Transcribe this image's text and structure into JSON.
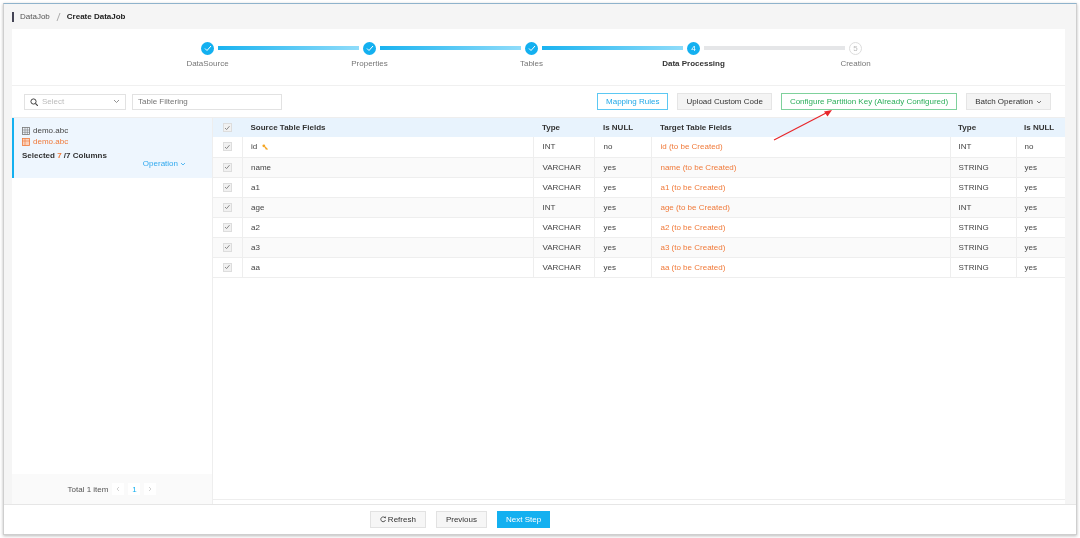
{
  "breadcrumb": [
    "DataJob",
    "Create DataJob"
  ],
  "steps": [
    {
      "label": "DataSource",
      "kind": "done"
    },
    {
      "label": "Properties",
      "kind": "done"
    },
    {
      "label": "Tables",
      "kind": "done"
    },
    {
      "label": "Data Processing",
      "kind": "current",
      "number": "4"
    },
    {
      "label": "Creation",
      "kind": "waiting",
      "number": "5"
    }
  ],
  "filters": {
    "select_placeholder": "Select",
    "table_placeholder": "Table Filtering"
  },
  "toolbar": [
    {
      "label": "Mapping Rules",
      "kind": "outline"
    },
    {
      "label": "Upload Custom Code",
      "kind": "plain"
    },
    {
      "label": "Configure Partition Key (Already Configured)",
      "kind": "success"
    },
    {
      "label": "Batch Operation",
      "kind": "dropdown"
    }
  ],
  "table_list": [
    {
      "source": "demo.abc",
      "target": "demo.abc",
      "selected": true,
      "summary_prefix": "Selected",
      "selected_count": "7",
      "summary_suffix": "/7 Columns",
      "operation": "Operation"
    }
  ],
  "pagination": {
    "total": "Total 1 item",
    "pages": [
      {
        "label": "1",
        "selected": true
      }
    ]
  },
  "table": {
    "header_checkbox": {
      "checked": true,
      "disabled": true
    },
    "columns": [
      "Source Table Fields",
      "Type",
      "Is NULL",
      "Target Table Fields",
      "Type",
      "Is NULL"
    ],
    "rows": [
      {
        "checked": true,
        "disabled": true,
        "source": "id",
        "primary_key": true,
        "type": "INT",
        "nullable": "no",
        "target": "id (to be Created)",
        "target_type": "INT",
        "target_nullable": "no"
      },
      {
        "checked": true,
        "disabled": true,
        "source": "name",
        "primary_key": false,
        "type": "VARCHAR",
        "nullable": "yes",
        "target": "name (to be Created)",
        "target_type": "STRING",
        "target_nullable": "yes"
      },
      {
        "checked": true,
        "disabled": true,
        "source": "a1",
        "primary_key": false,
        "type": "VARCHAR",
        "nullable": "yes",
        "target": "a1 (to be Created)",
        "target_type": "STRING",
        "target_nullable": "yes"
      },
      {
        "checked": true,
        "disabled": true,
        "source": "age",
        "primary_key": false,
        "type": "INT",
        "nullable": "yes",
        "target": "age (to be Created)",
        "target_type": "INT",
        "target_nullable": "yes"
      },
      {
        "checked": true,
        "disabled": true,
        "source": "a2",
        "primary_key": false,
        "type": "VARCHAR",
        "nullable": "yes",
        "target": "a2 (to be Created)",
        "target_type": "STRING",
        "target_nullable": "yes"
      },
      {
        "checked": true,
        "disabled": true,
        "source": "a3",
        "primary_key": false,
        "type": "VARCHAR",
        "nullable": "yes",
        "target": "a3 (to be Created)",
        "target_type": "STRING",
        "target_nullable": "yes"
      },
      {
        "checked": true,
        "disabled": true,
        "source": "aa",
        "primary_key": false,
        "type": "VARCHAR",
        "nullable": "yes",
        "target": "aa (to be Created)",
        "target_type": "STRING",
        "target_nullable": "yes"
      }
    ]
  },
  "footer_buttons": [
    {
      "label": "Refresh",
      "kind": "refresh"
    },
    {
      "label": "Previous",
      "kind": "plain"
    },
    {
      "label": "Next Step",
      "kind": "primary"
    }
  ]
}
